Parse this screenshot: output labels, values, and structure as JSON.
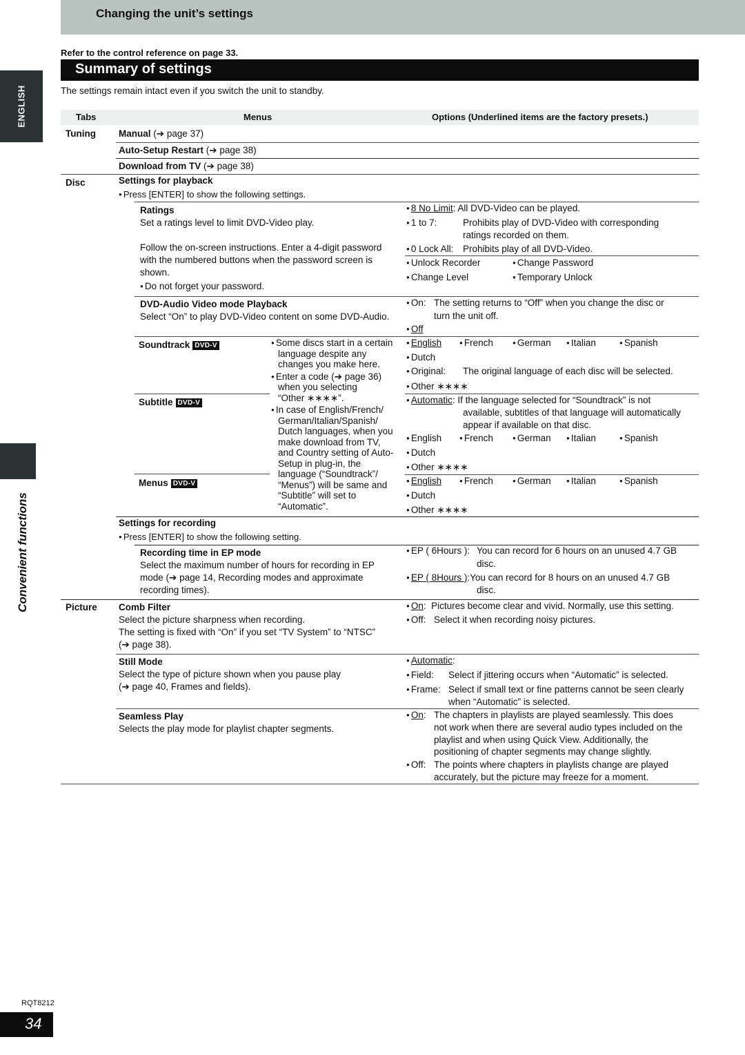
{
  "header": {
    "section_title": "Changing the unit’s settings",
    "refer_note": "Refer to the control reference on page 33.",
    "page_title": "Summary of settings",
    "intro": "The settings remain intact even if you switch the unit to standby."
  },
  "side": {
    "language_tab": "ENGLISH",
    "chapter_label": "Convenient functions"
  },
  "table": {
    "headers": {
      "tabs": "Tabs",
      "menus": "Menus",
      "options": "Options (Underlined items are the factory presets.)"
    },
    "tabs": {
      "tuning": "Tuning",
      "disc": "Disc",
      "picture": "Picture"
    },
    "tuning": {
      "manual": "Manual",
      "manual_ref": "(➔ page 37)",
      "auto_setup": "Auto-Setup Restart",
      "auto_setup_ref": "(➔ page 38)",
      "download": "Download from TV",
      "download_ref": "(➔ page 38)"
    },
    "disc": {
      "playback_heading": "Settings for playback",
      "playback_note": "Press [ENTER] to show the following settings.",
      "ratings": {
        "title": "Ratings",
        "desc": "Set a ratings level to limit DVD-Video play.",
        "follow_1": "Follow the on-screen instructions. Enter a 4-digit password",
        "follow_2": "with the numbered buttons when the password screen is",
        "follow_3": "shown.",
        "note": "Do not forget your password.",
        "opt_8": "8 No Limit",
        "opt_8_desc": ": All DVD-Video can be played.",
        "opt_1to7": "1 to 7:",
        "opt_1to7_desc_1": "Prohibits play of DVD-Video with corresponding",
        "opt_1to7_desc_2": "ratings recorded on them.",
        "opt_0": "0 Lock All:",
        "opt_0_desc": "Prohibits play of all DVD-Video.",
        "unlock_recorder": "Unlock Recorder",
        "change_password": "Change Password",
        "change_level": "Change Level",
        "temporary_unlock": "Temporary Unlock"
      },
      "dvd_audio": {
        "title": "DVD-Audio Video mode Playback",
        "desc": "Select “On” to play DVD-Video content on some DVD-Audio.",
        "on": "On:",
        "on_desc_1": "The setting returns to “Off” when you change the disc or",
        "on_desc_2": "turn the unit off.",
        "off": "Off"
      },
      "badge": "DVD-V",
      "soundtrack": {
        "title": "Soundtrack",
        "english": "English",
        "french": "French",
        "german": "German",
        "italian": "Italian",
        "spanish": "Spanish",
        "dutch": "Dutch",
        "original": "Original:",
        "original_desc": "The original language of each disc will be selected.",
        "other": "Other ∗∗∗∗"
      },
      "subtitle": {
        "title": "Subtitle",
        "automatic": "Automatic",
        "automatic_desc_1": ": If the language selected for “Soundtrack” is not",
        "automatic_desc_2": "available, subtitles of that language will automatically",
        "automatic_desc_3": "appear if available on that disc.",
        "english": "English",
        "french": "French",
        "german": "German",
        "italian": "Italian",
        "spanish": "Spanish",
        "dutch": "Dutch",
        "other": "Other ∗∗∗∗"
      },
      "menus": {
        "title": "Menus",
        "english": "English",
        "french": "French",
        "german": "German",
        "italian": "Italian",
        "spanish": "Spanish",
        "dutch": "Dutch",
        "other": "Other ∗∗∗∗"
      },
      "lang_notes": [
        "Some discs start in a certain",
        "language despite any",
        "changes you make here.",
        "Enter a code (➔ page 36)",
        "when you selecting",
        "“Other ∗∗∗∗”.",
        "In case of English/French/",
        "German/Italian/Spanish/",
        "Dutch languages, when you",
        "make download from TV,",
        "and Country setting of Auto-",
        "Setup in plug-in, the",
        "language (“Soundtrack”/",
        "“Menus”) will be same and",
        "“Subtitle” will set to",
        "“Automatic”."
      ],
      "recording_heading": "Settings for recording",
      "recording_note": "Press [ENTER] to show the following setting.",
      "ep": {
        "title": "Recording time in EP mode",
        "desc_1": "Select the maximum number of hours for recording in EP",
        "desc_2": "mode (➔ page 14, Recording modes and approximate",
        "desc_3": "recording times).",
        "opt6": "EP ( 6Hours ):",
        "opt6_desc_1": "You can record for 6 hours on an unused 4.7 GB",
        "opt6_desc_2": "disc.",
        "opt8": "EP ( 8Hours )",
        "opt8_desc_1": ":You can record for 8 hours on an unused 4.7 GB",
        "opt8_desc_2": "disc."
      }
    },
    "picture": {
      "comb": {
        "title": "Comb Filter",
        "desc_1": "Select the picture sharpness when recording.",
        "desc_2": "The setting is fixed with “On” if you set “TV System” to “NTSC”",
        "desc_3": "(➔ page 38).",
        "on": "On",
        "on_desc": ":  Pictures become clear and vivid. Normally, use this setting.",
        "off": "Off:",
        "off_desc": "Select it when recording noisy pictures."
      },
      "still": {
        "title": "Still Mode",
        "desc_1": "Select the type of picture shown when you pause play",
        "desc_2": "(➔ page 40, Frames and fields).",
        "automatic": "Automatic",
        "field": "Field:",
        "field_desc": "Select if jittering occurs when “Automatic” is selected.",
        "frame": "Frame:",
        "frame_desc_1": "Select if small text or fine patterns cannot be seen clearly",
        "frame_desc_2": "when “Automatic” is selected."
      },
      "seamless": {
        "title": "Seamless Play",
        "desc": "Selects the play mode for playlist chapter segments.",
        "on": "On",
        "on_desc_1": "The chapters in playlists are played seamlessly. This does",
        "on_desc_2": "not work when there are several audio types included on the",
        "on_desc_3": "playlist and when using Quick View. Additionally, the",
        "on_desc_4": "positioning of chapter segments may change slightly.",
        "off": "Off:",
        "off_desc_1": "The points where chapters in playlists change are played",
        "off_desc_2": "accurately, but the picture may freeze for a moment."
      }
    }
  },
  "footer": {
    "code": "RQT8212",
    "page_number": "34"
  }
}
